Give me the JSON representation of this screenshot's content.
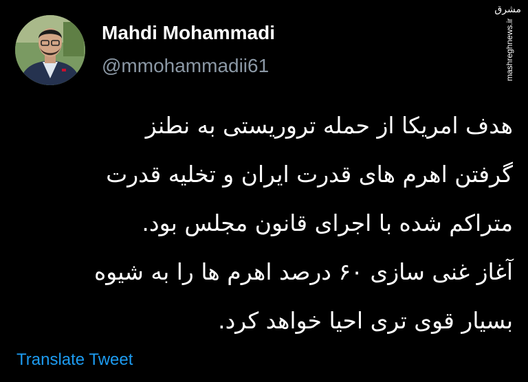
{
  "user": {
    "display_name": "Mahdi Mohammadi",
    "handle": "@mmohammadii61",
    "avatar_icon": "profile-photo"
  },
  "watermark": {
    "logo_text": "مشرق",
    "site_text": "mashreghnews.ir"
  },
  "tweet": {
    "lines": [
      "هدف امریکا از حمله تروریستی به نطنز",
      "گرفتن اهرم های قدرت ایران و تخلیه قدرت",
      "متراکم شده با اجرای قانون مجلس بود.",
      "آغاز غنی سازی ۶۰ درصد اهرم ها را به شیوه",
      "بسیار قوی تری احیا خواهد کرد."
    ]
  },
  "actions": {
    "translate_label": "Translate Tweet"
  },
  "colors": {
    "background": "#000000",
    "text": "#ffffff",
    "secondary_text": "#8b98a5",
    "link": "#1d9bf0"
  }
}
